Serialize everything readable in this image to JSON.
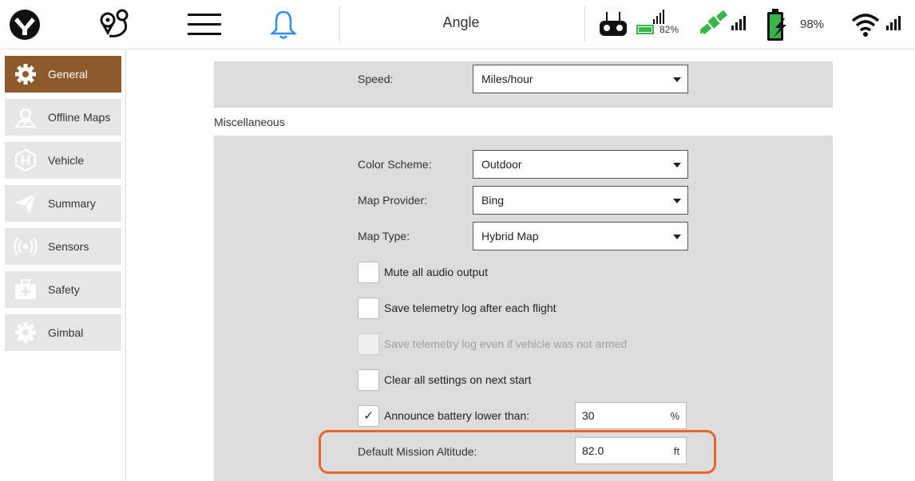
{
  "toolbar": {
    "app_icon": "qgc-logo-icon",
    "plan_icon": "plan-route-icon",
    "menu_icon": "hamburger-menu-icon",
    "notifications_icon": "bell-icon",
    "flight_mode": "Angle",
    "rc": {
      "icon": "rc-controller-icon",
      "rssi_percent": "82%"
    },
    "gps_icon": "satellite-icon",
    "battery": {
      "icon": "battery-icon",
      "percent": "98%"
    },
    "telemetry_icon": "wifi-signal-icon",
    "colors": {
      "accent_blue": "#2a8ef0",
      "battery_green": "#39b54a"
    }
  },
  "sidebar": {
    "active_color": "#8c5a2b",
    "items": [
      {
        "label": "General",
        "icon": "gear-icon",
        "active": true
      },
      {
        "label": "Offline Maps",
        "icon": "map-pin-icon",
        "active": false
      },
      {
        "label": "Vehicle",
        "icon": "hexagon-h-icon",
        "active": false
      },
      {
        "label": "Summary",
        "icon": "paper-plane-icon",
        "active": false
      },
      {
        "label": "Sensors",
        "icon": "radio-waves-icon",
        "active": false
      },
      {
        "label": "Safety",
        "icon": "first-aid-kit-icon",
        "active": false
      },
      {
        "label": "Gimbal",
        "icon": "gear-icon",
        "active": false
      }
    ]
  },
  "units": {
    "speed_label": "Speed:",
    "speed_value": "Miles/hour"
  },
  "misc": {
    "title": "Miscellaneous",
    "color_scheme_label": "Color Scheme:",
    "color_scheme_value": "Outdoor",
    "map_provider_label": "Map Provider:",
    "map_provider_value": "Bing",
    "map_type_label": "Map Type:",
    "map_type_value": "Hybrid Map",
    "mute_audio_label": "Mute all audio output",
    "mute_audio_checked": false,
    "save_log_label": "Save telemetry log after each flight",
    "save_log_checked": false,
    "save_log_unarmed_label": "Save telemetry log even if vehicle was not armed",
    "save_log_unarmed_checked": false,
    "clear_settings_label": "Clear all settings on next start",
    "clear_settings_checked": false,
    "announce_battery_label": "Announce battery lower than:",
    "announce_battery_checked": true,
    "announce_battery_check_mark": "✓",
    "announce_battery_value": "30",
    "announce_battery_unit": "%",
    "mission_altitude_label": "Default Mission Altitude:",
    "mission_altitude_value": "82.0",
    "mission_altitude_unit": "ft",
    "highlight_color": "#e8642a"
  }
}
